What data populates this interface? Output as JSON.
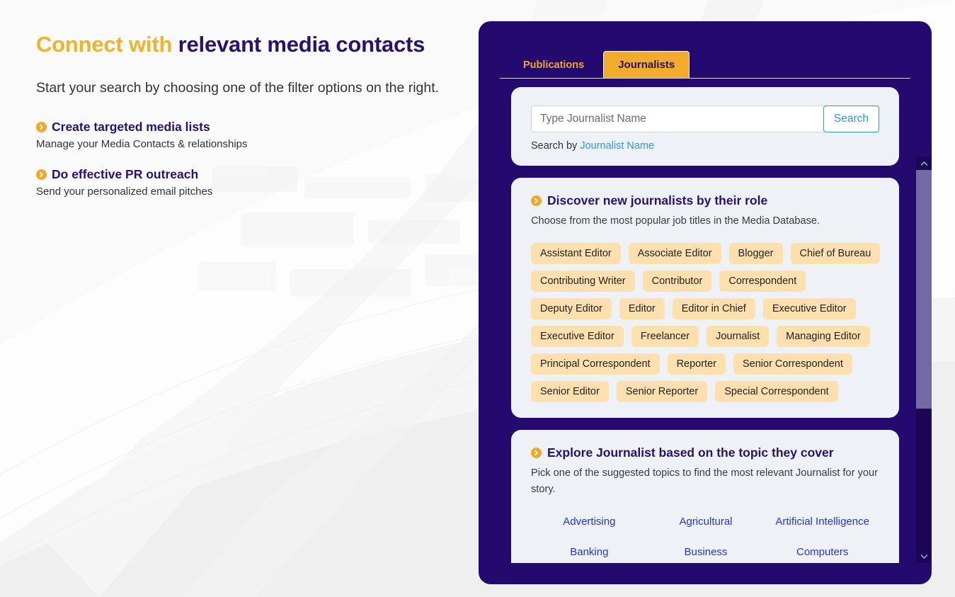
{
  "hero": {
    "title_accent": "Connect with ",
    "title_rest": "relevant media contacts",
    "subtitle": "Start your search by choosing one of the filter options on the right.",
    "links": [
      {
        "icon": "chevron-right-circle-icon",
        "title": "Create targeted media lists",
        "desc": "Manage your Media Contacts & relationships"
      },
      {
        "icon": "chevron-right-circle-icon",
        "title": "Do effective PR outreach",
        "desc": "Send your personalized email pitches"
      }
    ]
  },
  "panel": {
    "tabs": [
      {
        "label": "Publications",
        "active": false
      },
      {
        "label": "Journalists",
        "active": true
      }
    ],
    "search": {
      "placeholder": "Type Journalist Name",
      "value": "",
      "button_label": "Search",
      "hint_prefix": "Search by ",
      "hint_link": "Journalist Name"
    },
    "roles_card": {
      "icon": "chevron-right-circle-icon",
      "title": "Discover new journalists by their role",
      "desc": "Choose from the most popular job titles in the Media Database.",
      "tags": [
        "Assistant Editor",
        "Associate Editor",
        "Blogger",
        "Chief of Bureau",
        "Contributing Writer",
        "Contributor",
        "Correspondent",
        "Deputy Editor",
        "Editor",
        "Editor in Chief",
        "Executive Editor",
        "Executive Editor",
        "Freelancer",
        "Journalist",
        "Managing Editor",
        "Principal Correspondent",
        "Reporter",
        "Senior Correspondent",
        "Senior Editor",
        "Senior Reporter",
        "Special Correspondent"
      ]
    },
    "topics_card": {
      "icon": "chevron-right-circle-icon",
      "title": "Explore Journalist based on the topic they cover",
      "desc": "Pick one of the suggested topics to find the most relevant Journalist for your story.",
      "topics": [
        "Advertising",
        "Agricultural",
        "Artificial Intelligence",
        "Banking",
        "Business",
        "Computers"
      ]
    },
    "scrollbar": {
      "up_icon": "chevron-up-icon",
      "down_icon": "chevron-down-icon"
    }
  },
  "colors": {
    "panel_bg": "#240a6e",
    "accent_yellow": "#f0a82a",
    "deep_purple": "#2a1070",
    "card_bg": "#eef2f7",
    "tag_bg": "#fde0ad",
    "link_blue": "#2435d8",
    "search_blue": "#2e95f2"
  }
}
